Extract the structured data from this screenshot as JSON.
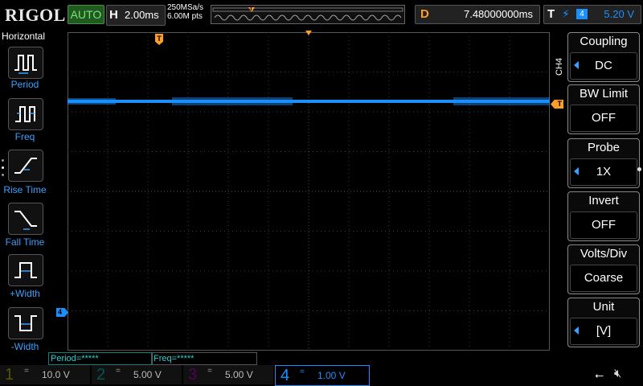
{
  "topbar": {
    "logo": "RIGOL",
    "run_mode": "AUTO",
    "h_key": "H",
    "timebase": "2.00ms",
    "sample_rate": "250MSa/s",
    "memory_depth": "6.00M pts",
    "trigger_marker": "T",
    "delay_key": "D",
    "delay_value": "7.48000000ms",
    "trig_key": "T",
    "trig_source": "4",
    "trig_level": "5.20 V"
  },
  "left_menu": {
    "title": "Horizontal",
    "items": [
      {
        "label": "Period",
        "icon": "period-icon"
      },
      {
        "label": "Freq",
        "icon": "frequency-icon"
      },
      {
        "label": "Rise Time",
        "icon": "rise-time-icon"
      },
      {
        "label": "Fall Time",
        "icon": "fall-time-icon"
      },
      {
        "label": "+Width",
        "icon": "positive-width-icon"
      },
      {
        "label": "-Width",
        "icon": "negative-width-icon"
      }
    ]
  },
  "right_menu": {
    "channel_label": "CH4",
    "items": [
      {
        "title": "Coupling",
        "value": "DC",
        "has_arrow": true
      },
      {
        "title": "BW Limit",
        "value": "OFF",
        "has_arrow": false
      },
      {
        "title": "Probe",
        "value": "1X",
        "has_arrow": true
      },
      {
        "title": "Invert",
        "value": "OFF",
        "has_arrow": false
      },
      {
        "title": "Volts/Div",
        "value": "Coarse",
        "has_arrow": false
      },
      {
        "title": "Unit",
        "value": "[V]",
        "has_arrow": true
      }
    ]
  },
  "grid_markers": {
    "trigger_marker": "T",
    "channel_marker": "4",
    "trigger_level_marker": "T"
  },
  "measurements": {
    "period": "Period=*****",
    "freq": "Freq=*****"
  },
  "channels": [
    {
      "num": "1",
      "coupling": "=",
      "scale": "10.0 V",
      "color": "#c8c800"
    },
    {
      "num": "2",
      "coupling": "=",
      "scale": "5.00 V",
      "color": "#00c8c8"
    },
    {
      "num": "3",
      "coupling": "=",
      "scale": "5.00 V",
      "color": "#c800c8"
    },
    {
      "num": "4",
      "coupling": "=",
      "scale": "1.00 V",
      "color": "#1a90ff"
    }
  ],
  "status": {
    "usb_icon": "usb-icon",
    "speaker_icon": "speaker-muted-icon"
  },
  "colors": {
    "ch4": "#1a90ff",
    "trigger": "#ff9d2a",
    "grid": "#3a3a3a"
  }
}
